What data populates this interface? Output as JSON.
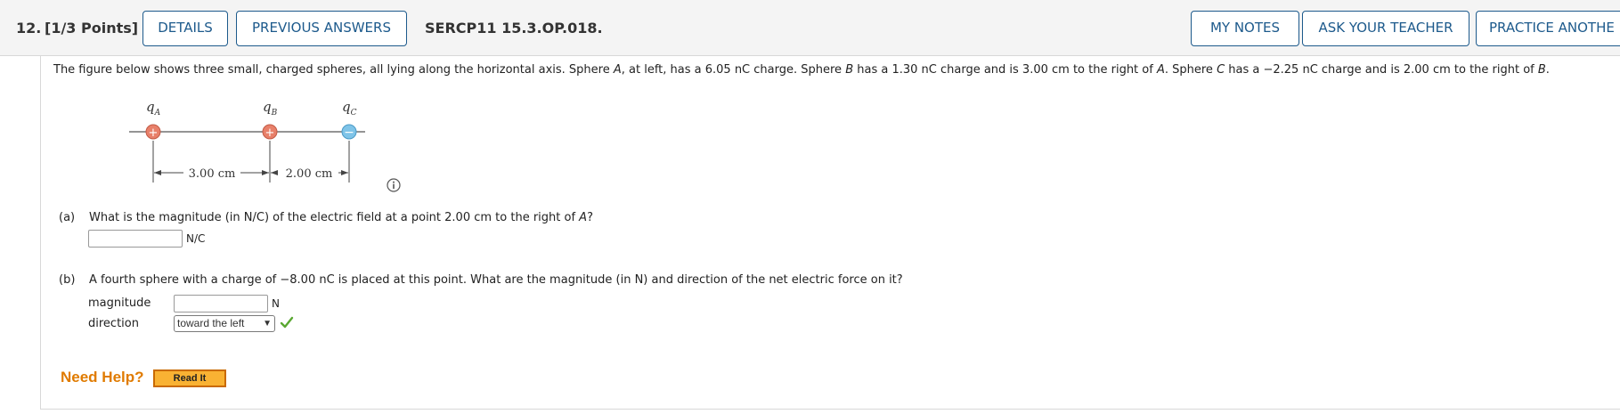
{
  "header": {
    "number": "12.",
    "points": "[1/3 Points]",
    "details_label": "DETAILS",
    "previous_answers_label": "PREVIOUS ANSWERS",
    "question_id": "SERCP11 15.3.OP.018.",
    "my_notes_label": "MY NOTES",
    "ask_teacher_label": "ASK YOUR TEACHER",
    "practice_label": "PRACTICE ANOTHE"
  },
  "prompt": {
    "p1": "The figure below shows three small, charged spheres, all lying along the horizontal axis. Sphere ",
    "a1": "A",
    "p2": ", at left, has a 6.05 nC charge. Sphere ",
    "b1": "B",
    "p3": " has a 1.30 nC charge and is 3.00 cm to the right of ",
    "a2": "A",
    "p4": ". Sphere ",
    "c1": "C",
    "p5": " has a −2.25 nC charge and is 2.00 cm to the right of ",
    "b2": "B",
    "p6": "."
  },
  "figure": {
    "qa_letter": "q",
    "qa_sub": "A",
    "qb_letter": "q",
    "qb_sub": "B",
    "qc_letter": "q",
    "qc_sub": "C",
    "dist_ab": "3.00 cm",
    "dist_bc": "2.00 cm",
    "plus": "+",
    "minus": "−"
  },
  "part_a": {
    "tag": "(a)",
    "question_pre": "What is the magnitude (in N/C) of the electric field at a point 2.00 cm to the right of ",
    "question_var": "A",
    "question_post": "?",
    "value": "",
    "unit": "N/C"
  },
  "part_b": {
    "tag": "(b)",
    "question": "A fourth sphere with a charge of −8.00 nC is placed at this point. What are the magnitude (in N) and direction of the net electric force on it?",
    "magnitude_label": "magnitude",
    "magnitude_value": "",
    "magnitude_unit": "N",
    "direction_label": "direction",
    "direction_selected": "toward the left",
    "direction_status": "correct"
  },
  "help": {
    "need_help": "Need Help?",
    "read_it": "Read It"
  },
  "colors": {
    "accent_blue": "#1d5a8c",
    "positive_sphere": "#e8806a",
    "negative_sphere": "#7fc4e8",
    "help_orange": "#e07b00",
    "check_green": "#5aa832"
  }
}
